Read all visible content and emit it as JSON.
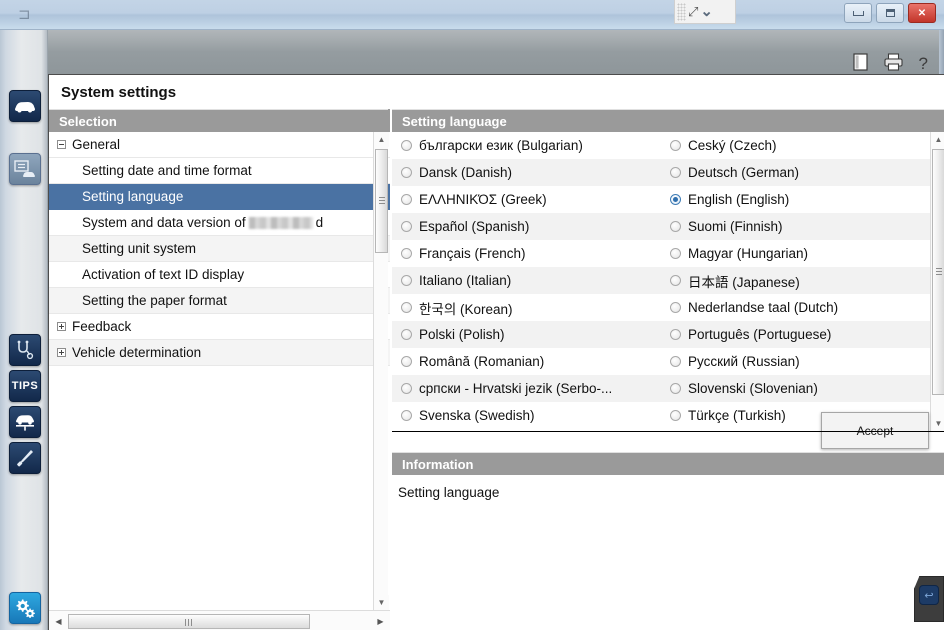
{
  "window": {
    "logo_glyph": "⊐",
    "float_toolbar": {
      "fullscreen_icon": "⤢",
      "chevron_icon": "⌄"
    },
    "buttons": {
      "minimize": "minimize-button",
      "maximize": "maximize-button",
      "close": "✕"
    }
  },
  "sidebar": {
    "items": [
      {
        "name": "vehicle-icon",
        "state": "active-dark"
      },
      {
        "name": "vehicle-documents-icon",
        "state": "muted"
      },
      {
        "name": "diagnostics-icon",
        "state": "dark"
      },
      {
        "name": "tips-icon",
        "label": "TIPS",
        "state": "dark"
      },
      {
        "name": "vehicle-lift-icon",
        "state": "dark"
      },
      {
        "name": "measurement-tool-icon",
        "state": "dark"
      },
      {
        "name": "settings-gears-icon",
        "state": "selected-blue"
      }
    ]
  },
  "toolbar": {
    "book_icon": "book-icon",
    "print_icon": "printer-icon",
    "help_label": "?"
  },
  "page": {
    "title": "System settings"
  },
  "selection": {
    "header": "Selection",
    "rows": [
      {
        "label": "General",
        "level": "root",
        "toggle": "minus",
        "selected": false
      },
      {
        "label": "Setting date and time format",
        "level": "child",
        "toggle": "none",
        "selected": false
      },
      {
        "label": "Setting language",
        "level": "child",
        "toggle": "none",
        "selected": true
      },
      {
        "label_before": "System and data version of",
        "redacted": true,
        "label_after": "d",
        "level": "child",
        "toggle": "none",
        "selected": false
      },
      {
        "label": "Setting unit system",
        "level": "child",
        "toggle": "none",
        "selected": false
      },
      {
        "label": "Activation of text ID display",
        "level": "child",
        "toggle": "none",
        "selected": false
      },
      {
        "label": "Setting the paper format",
        "level": "child",
        "toggle": "none",
        "selected": false
      },
      {
        "label": "Feedback",
        "level": "root",
        "toggle": "plus",
        "selected": false
      },
      {
        "label": "Vehicle determination",
        "level": "root",
        "toggle": "plus",
        "selected": false
      }
    ]
  },
  "setting_language": {
    "header": "Setting language",
    "left_column": [
      {
        "label": "български език (Bulgarian)",
        "selected": false
      },
      {
        "label": "Dansk (Danish)",
        "selected": false
      },
      {
        "label": "ΕΛΛΗΝΙΚΌΣ (Greek)",
        "selected": false
      },
      {
        "label": "Español (Spanish)",
        "selected": false
      },
      {
        "label": "Français (French)",
        "selected": false
      },
      {
        "label": "Italiano (Italian)",
        "selected": false
      },
      {
        "label": "한국의 (Korean)",
        "selected": false
      },
      {
        "label": "Polski (Polish)",
        "selected": false
      },
      {
        "label": "Română (Romanian)",
        "selected": false
      },
      {
        "label": "српски - Hrvatski jezik (Serbo-...",
        "selected": false
      },
      {
        "label": "Svenska (Swedish)",
        "selected": false
      }
    ],
    "right_column": [
      {
        "label": "Ceský (Czech)",
        "selected": false
      },
      {
        "label": "Deutsch (German)",
        "selected": false
      },
      {
        "label": "English (English)",
        "selected": true
      },
      {
        "label": "Suomi (Finnish)",
        "selected": false
      },
      {
        "label": "Magyar (Hungarian)",
        "selected": false
      },
      {
        "label": "日本語 (Japanese)",
        "selected": false
      },
      {
        "label": "Nederlandse taal (Dutch)",
        "selected": false
      },
      {
        "label": "Português (Portuguese)",
        "selected": false
      },
      {
        "label": "Русский (Russian)",
        "selected": false
      },
      {
        "label": "Slovenski (Slovenian)",
        "selected": false
      },
      {
        "label": "Türkçe (Turkish)",
        "selected": false
      }
    ],
    "accept_label": "Accept"
  },
  "information": {
    "header": "Information",
    "text": "Setting language"
  },
  "scroll": {
    "up_arrow": "▲",
    "down_arrow": "▼",
    "left_arrow": "◀",
    "right_arrow": "▶"
  },
  "back_button": {
    "name": "back-button",
    "glyph": "↩"
  },
  "colors": {
    "selection_blue": "#4a72a3",
    "header_gray": "#9a9a9a",
    "accent_blue": "#2ea8e0",
    "close_red": "#c2352a"
  }
}
